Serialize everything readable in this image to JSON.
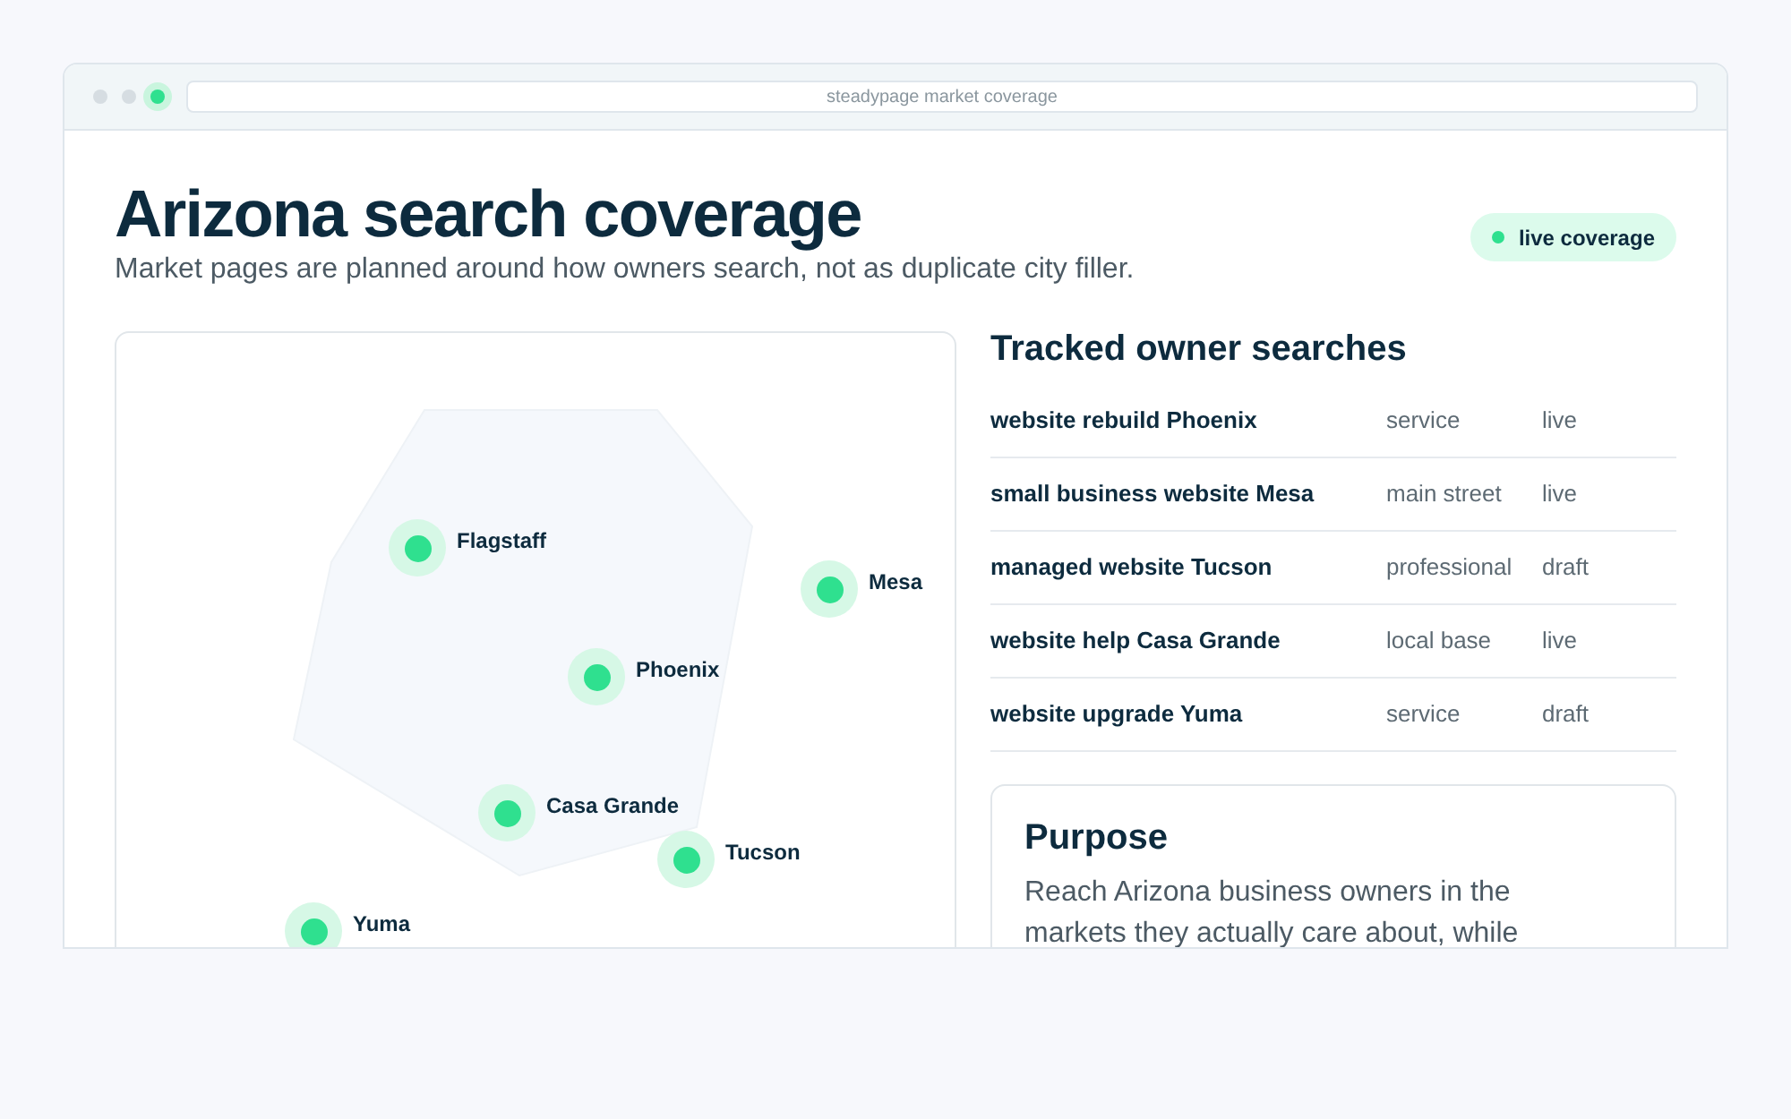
{
  "browser": {
    "address": "steadypage market coverage"
  },
  "header": {
    "title": "Arizona search coverage",
    "subtitle": "Market pages are planned around how owners search, not as duplicate city filler.",
    "badge": "live coverage"
  },
  "map": {
    "cities": [
      {
        "name": "Flagstaff"
      },
      {
        "name": "Mesa"
      },
      {
        "name": "Phoenix"
      },
      {
        "name": "Casa Grande"
      },
      {
        "name": "Tucson"
      },
      {
        "name": "Yuma"
      }
    ]
  },
  "searches": {
    "title": "Tracked owner searches",
    "rows": [
      {
        "query": "website rebuild Phoenix",
        "segment": "service",
        "status": "live"
      },
      {
        "query": "small business website Mesa",
        "segment": "main street",
        "status": "live"
      },
      {
        "query": "managed website Tucson",
        "segment": "professional",
        "status": "draft"
      },
      {
        "query": "website help Casa Grande",
        "segment": "local base",
        "status": "live"
      },
      {
        "query": "website upgrade Yuma",
        "segment": "service",
        "status": "draft"
      }
    ]
  },
  "purpose": {
    "title": "Purpose",
    "text": "Reach Arizona business owners in the markets they actually care about, while"
  }
}
